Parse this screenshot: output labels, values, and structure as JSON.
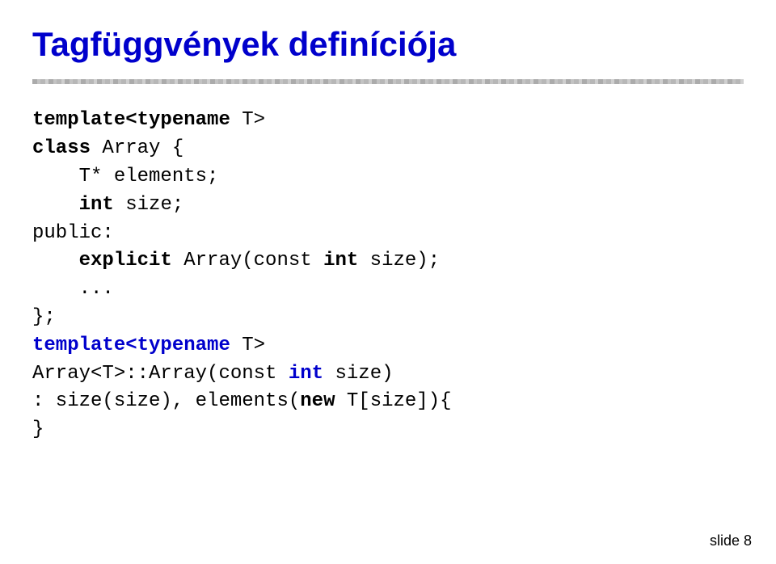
{
  "title": "Tagfüggvények definíciója",
  "slide_number": "slide 8",
  "code_lines": [
    {
      "id": "line1",
      "parts": [
        {
          "text": "template<typename ",
          "bold": true,
          "blue": false
        },
        {
          "text": "T>",
          "bold": false,
          "blue": false
        }
      ]
    },
    {
      "id": "line2",
      "parts": [
        {
          "text": "class",
          "bold": true,
          "blue": false
        },
        {
          "text": " Array {",
          "bold": false,
          "blue": false
        }
      ]
    },
    {
      "id": "line3",
      "parts": [
        {
          "text": "    T* elements;",
          "bold": false,
          "blue": false
        }
      ]
    },
    {
      "id": "line4",
      "parts": [
        {
          "text": "    ",
          "bold": false,
          "blue": false
        },
        {
          "text": "int",
          "bold": true,
          "blue": false
        },
        {
          "text": " size;",
          "bold": false,
          "blue": false
        }
      ]
    },
    {
      "id": "line5",
      "parts": [
        {
          "text": "public:",
          "bold": false,
          "blue": false
        }
      ]
    },
    {
      "id": "line6",
      "parts": [
        {
          "text": "    ",
          "bold": false,
          "blue": false
        },
        {
          "text": "explicit",
          "bold": true,
          "blue": false
        },
        {
          "text": " Array(",
          "bold": false,
          "blue": false
        },
        {
          "text": "const",
          "bold": false,
          "blue": false
        },
        {
          "text": " ",
          "bold": false,
          "blue": false
        },
        {
          "text": "int",
          "bold": true,
          "blue": false
        },
        {
          "text": " size);",
          "bold": false,
          "blue": false
        }
      ]
    },
    {
      "id": "line7",
      "parts": [
        {
          "text": "    ...",
          "bold": false,
          "blue": false
        }
      ]
    },
    {
      "id": "line8",
      "parts": [
        {
          "text": "};",
          "bold": false,
          "blue": false
        }
      ]
    },
    {
      "id": "line9",
      "parts": [
        {
          "text": "template<typename ",
          "bold": true,
          "blue": true
        },
        {
          "text": "T>",
          "bold": false,
          "blue": false
        }
      ]
    },
    {
      "id": "line10",
      "parts": [
        {
          "text": "Array<T>::Array(",
          "bold": false,
          "blue": false
        },
        {
          "text": "const",
          "bold": false,
          "blue": false
        },
        {
          "text": " ",
          "bold": false,
          "blue": false
        },
        {
          "text": "int",
          "bold": true,
          "blue": true
        },
        {
          "text": " size)",
          "bold": false,
          "blue": false
        }
      ]
    },
    {
      "id": "line11",
      "parts": [
        {
          "text": ": size(size), elements(",
          "bold": false,
          "blue": false
        },
        {
          "text": "new",
          "bold": true,
          "blue": false
        },
        {
          "text": " T[size]){",
          "bold": false,
          "blue": false
        }
      ]
    },
    {
      "id": "line12",
      "parts": [
        {
          "text": "}",
          "bold": false,
          "blue": false
        }
      ]
    }
  ]
}
